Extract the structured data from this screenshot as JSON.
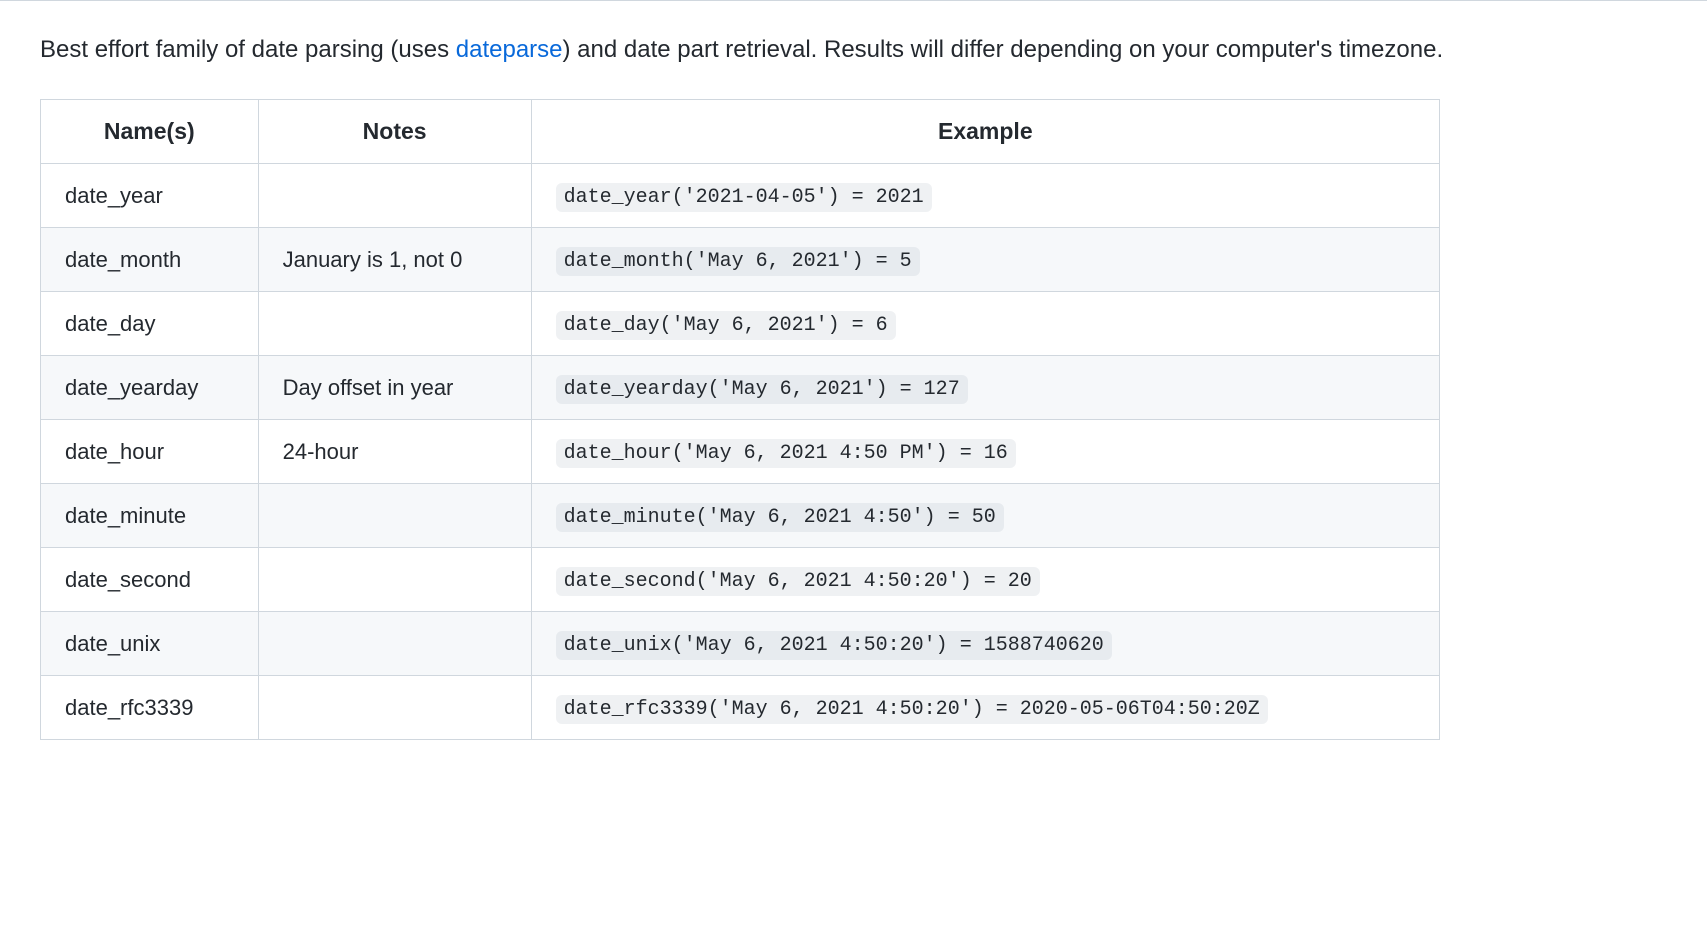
{
  "intro": {
    "text_before_link": "Best effort family of date parsing (uses ",
    "link_text": "dateparse",
    "text_after_link": ") and date part retrieval. Results will differ depending on your computer's timezone."
  },
  "table": {
    "headers": [
      "Name(s)",
      "Notes",
      "Example"
    ],
    "rows": [
      {
        "name": "date_year",
        "notes": "",
        "example": "date_year('2021-04-05') = 2021"
      },
      {
        "name": "date_month",
        "notes": "January is 1, not 0",
        "example": "date_month('May 6, 2021') = 5"
      },
      {
        "name": "date_day",
        "notes": "",
        "example": "date_day('May 6, 2021') = 6"
      },
      {
        "name": "date_yearday",
        "notes": "Day offset in year",
        "example": "date_yearday('May 6, 2021') = 127"
      },
      {
        "name": "date_hour",
        "notes": "24-hour",
        "example": "date_hour('May 6, 2021 4:50 PM') = 16"
      },
      {
        "name": "date_minute",
        "notes": "",
        "example": "date_minute('May 6, 2021 4:50') = 50"
      },
      {
        "name": "date_second",
        "notes": "",
        "example": "date_second('May 6, 2021 4:50:20') = 20"
      },
      {
        "name": "date_unix",
        "notes": "",
        "example": "date_unix('May 6, 2021 4:50:20') = 1588740620"
      },
      {
        "name": "date_rfc3339",
        "notes": "",
        "example": "date_rfc3339('May 6, 2021 4:50:20') = 2020-05-06T04:50:20Z"
      }
    ]
  }
}
